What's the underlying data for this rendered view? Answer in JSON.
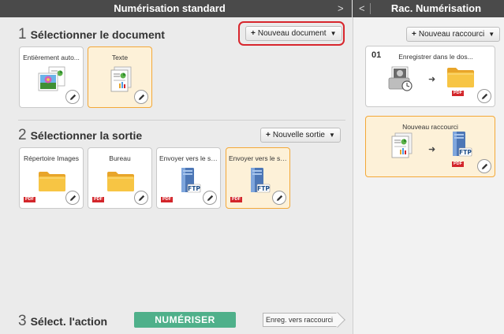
{
  "header": {
    "left_title": "Numérisation standard",
    "left_arrow": ">",
    "right_arrow": "<",
    "right_title": "Rac. Numérisation"
  },
  "step1": {
    "number": "1",
    "title": "Sélectionner le document",
    "new_button": "Nouveau document",
    "cards": [
      {
        "label": "Entièrement auto...",
        "icon": "photo-document-icon",
        "selected": false
      },
      {
        "label": "Texte",
        "icon": "text-document-icon",
        "selected": true
      }
    ]
  },
  "step2": {
    "number": "2",
    "title": "Sélectionner la sortie",
    "new_button": "Nouvelle sortie",
    "cards": [
      {
        "label": "Répertoire Images",
        "icon": "folder-icon",
        "badge": "PDF",
        "selected": false
      },
      {
        "label": "Bureau",
        "icon": "folder-icon",
        "badge": "PDF",
        "selected": false
      },
      {
        "label": "Envoyer vers le ser...",
        "icon": "ftp-server-icon",
        "badge": "PDF",
        "selected": false
      },
      {
        "label": "Envoyer vers le ser...",
        "icon": "ftp-server-icon",
        "badge": "PDF",
        "selected": true
      }
    ]
  },
  "step3": {
    "number": "3",
    "title": "Sélect. l'action",
    "scan_button": "NUMÉRISER",
    "save_button": "Enreg. vers raccourci"
  },
  "shortcuts": {
    "new_button": "Nouveau raccourci",
    "items": [
      {
        "number": "01",
        "label": "Enregistrer dans le dos...",
        "badge": "PDF",
        "selected": false
      },
      {
        "number": "",
        "label": "Nouveau raccourci",
        "badge": "PDF",
        "selected": true
      }
    ]
  },
  "ftp_label": "FTP",
  "colors": {
    "header_bg": "#4a4a4a",
    "selected_bg": "#fdf1d8",
    "selected_border": "#f3a838",
    "scan_button": "#4fb08a",
    "highlight_ring": "#d8262d",
    "pdf_badge": "#d3262b"
  }
}
